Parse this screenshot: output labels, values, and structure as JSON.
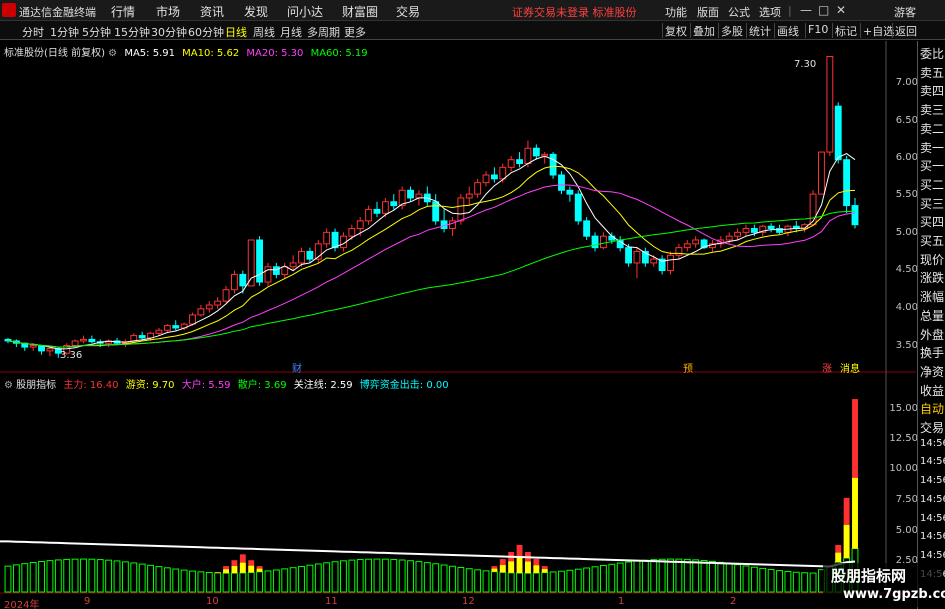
{
  "menubar": {
    "app_title": "通达信金融终端",
    "items": [
      "行情",
      "市场",
      "资讯",
      "发现",
      "问小达",
      "财富圈",
      "交易"
    ],
    "center_message": "证券交易未登录  标准股份",
    "right_items": [
      "功能",
      "版面",
      "公式",
      "选项",
      "|",
      "游客"
    ],
    "window_controls": [
      "—",
      "□",
      "✕"
    ]
  },
  "toolbar": {
    "periods": [
      "分时",
      "1分钟",
      "5分钟",
      "15分钟",
      "30分钟",
      "60分钟",
      "日线",
      "周线",
      "月线",
      "多周期",
      "更多"
    ],
    "active_period": "日线",
    "right_buttons": [
      "复权",
      "叠加",
      "多股",
      "统计",
      "画线",
      "F10",
      "标记",
      "+自选",
      "返回"
    ]
  },
  "main_legend": {
    "title": "标准股份(日线 前复权)",
    "ma": [
      {
        "label": "MA5: 5.91",
        "color": "#ffffff"
      },
      {
        "label": "MA10: 5.62",
        "color": "#ffff00"
      },
      {
        "label": "MA20: 5.30",
        "color": "#ff40ff"
      },
      {
        "label": "MA60: 5.19",
        "color": "#00ff00"
      }
    ]
  },
  "indicator_legend": {
    "title": "股朋指标",
    "items": [
      {
        "label": "主力: 16.40",
        "color": "#ff3030"
      },
      {
        "label": "游资: 9.70",
        "color": "#ffff00"
      },
      {
        "label": "大户: 5.59",
        "color": "#ff40ff"
      },
      {
        "label": "散户: 3.69",
        "color": "#00ff00"
      },
      {
        "label": "关注线: 2.59",
        "color": "#ffffff"
      },
      {
        "label": "博弈资金出击: 0.00",
        "color": "#00ffff"
      }
    ]
  },
  "price_axis": [
    "7.00",
    "6.50",
    "6.00",
    "5.50",
    "5.00",
    "4.50",
    "4.00",
    "3.50"
  ],
  "indicator_axis": [
    "15.00",
    "12.50",
    "10.00",
    "7.50",
    "5.00",
    "2.50"
  ],
  "date_axis": [
    "2024年",
    "9",
    "10",
    "11",
    "12",
    "1",
    "2"
  ],
  "annotations": {
    "high": "7.30",
    "low": "3.36",
    "marks": [
      {
        "text": "财",
        "color": "#4080ff"
      },
      {
        "text": "预",
        "color": "#ffb000"
      },
      {
        "text": "涨",
        "color": "#ff4040"
      },
      {
        "text": "消息",
        "color": "#ffff00"
      }
    ]
  },
  "right_panel": {
    "items": [
      "委比",
      "卖五",
      "卖四",
      "卖三",
      "卖二",
      "卖一",
      "买一",
      "买二",
      "买三",
      "买四",
      "买五",
      "现价",
      "涨跌",
      "涨幅",
      "总量",
      "外盘",
      "换手",
      "净资",
      "收益",
      "自动",
      "交易",
      "14:56",
      "14:56",
      "14:56",
      "14:56",
      "14:56",
      "14:56",
      "14:56",
      "14:56"
    ]
  },
  "watermark": {
    "line1": "股朋指标网",
    "line2": "www.7gpzb.com"
  },
  "chart_data": [
    {
      "type": "candlestick",
      "title": "标准股份(日线 前复权)",
      "ylim": [
        3.2,
        7.45
      ],
      "x_labels": [
        "2024年",
        "9",
        "10",
        "11",
        "12",
        "1",
        "2"
      ],
      "candles": [
        [
          3.6,
          3.62,
          3.55,
          3.58
        ],
        [
          3.58,
          3.6,
          3.5,
          3.55
        ],
        [
          3.55,
          3.56,
          3.45,
          3.5
        ],
        [
          3.5,
          3.55,
          3.45,
          3.52
        ],
        [
          3.52,
          3.53,
          3.4,
          3.45
        ],
        [
          3.45,
          3.5,
          3.38,
          3.48
        ],
        [
          3.48,
          3.5,
          3.36,
          3.42
        ],
        [
          3.42,
          3.55,
          3.4,
          3.52
        ],
        [
          3.52,
          3.6,
          3.5,
          3.58
        ],
        [
          3.58,
          3.65,
          3.55,
          3.6
        ],
        [
          3.6,
          3.65,
          3.55,
          3.57
        ],
        [
          3.57,
          3.6,
          3.5,
          3.55
        ],
        [
          3.55,
          3.6,
          3.5,
          3.58
        ],
        [
          3.58,
          3.62,
          3.53,
          3.55
        ],
        [
          3.55,
          3.6,
          3.5,
          3.57
        ],
        [
          3.57,
          3.68,
          3.55,
          3.65
        ],
        [
          3.65,
          3.7,
          3.6,
          3.62
        ],
        [
          3.62,
          3.7,
          3.58,
          3.68
        ],
        [
          3.68,
          3.75,
          3.65,
          3.72
        ],
        [
          3.72,
          3.8,
          3.7,
          3.78
        ],
        [
          3.78,
          3.85,
          3.72,
          3.75
        ],
        [
          3.75,
          3.82,
          3.72,
          3.8
        ],
        [
          3.8,
          3.95,
          3.78,
          3.92
        ],
        [
          3.92,
          4.05,
          3.9,
          4.0
        ],
        [
          4.0,
          4.1,
          3.95,
          4.05
        ],
        [
          4.05,
          4.15,
          4.0,
          4.1
        ],
        [
          4.1,
          4.3,
          4.08,
          4.25
        ],
        [
          4.25,
          4.5,
          4.2,
          4.45
        ],
        [
          4.45,
          4.5,
          4.2,
          4.3
        ],
        [
          4.3,
          4.9,
          4.3,
          4.9
        ],
        [
          4.9,
          4.95,
          4.3,
          4.35
        ],
        [
          4.35,
          4.6,
          4.3,
          4.55
        ],
        [
          4.55,
          4.6,
          4.4,
          4.45
        ],
        [
          4.45,
          4.6,
          4.4,
          4.55
        ],
        [
          4.55,
          4.7,
          4.5,
          4.6
        ],
        [
          4.6,
          4.8,
          4.55,
          4.75
        ],
        [
          4.75,
          4.8,
          4.6,
          4.65
        ],
        [
          4.65,
          4.9,
          4.6,
          4.85
        ],
        [
          4.85,
          5.05,
          4.8,
          5.0
        ],
        [
          5.0,
          5.05,
          4.75,
          4.8
        ],
        [
          4.8,
          5.0,
          4.75,
          4.95
        ],
        [
          4.95,
          5.1,
          4.9,
          5.05
        ],
        [
          5.05,
          5.2,
          4.95,
          5.15
        ],
        [
          5.15,
          5.35,
          5.1,
          5.3
        ],
        [
          5.3,
          5.4,
          5.2,
          5.25
        ],
        [
          5.25,
          5.45,
          5.2,
          5.4
        ],
        [
          5.4,
          5.5,
          5.3,
          5.35
        ],
        [
          5.35,
          5.6,
          5.3,
          5.55
        ],
        [
          5.55,
          5.6,
          5.4,
          5.45
        ],
        [
          5.45,
          5.55,
          5.35,
          5.5
        ],
        [
          5.5,
          5.6,
          5.35,
          5.4
        ],
        [
          5.4,
          5.5,
          5.1,
          5.15
        ],
        [
          5.15,
          5.3,
          5.0,
          5.05
        ],
        [
          5.05,
          5.2,
          4.95,
          5.15
        ],
        [
          5.15,
          5.5,
          5.1,
          5.45
        ],
        [
          5.45,
          5.6,
          5.35,
          5.5
        ],
        [
          5.5,
          5.7,
          5.45,
          5.65
        ],
        [
          5.65,
          5.8,
          5.6,
          5.75
        ],
        [
          5.75,
          5.85,
          5.65,
          5.7
        ],
        [
          5.7,
          5.9,
          5.65,
          5.85
        ],
        [
          5.85,
          6.0,
          5.8,
          5.95
        ],
        [
          5.95,
          6.05,
          5.85,
          5.9
        ],
        [
          5.9,
          6.2,
          5.85,
          6.1
        ],
        [
          6.1,
          6.15,
          5.95,
          6.0
        ],
        [
          6.0,
          6.05,
          5.9,
          6.02
        ],
        [
          6.02,
          6.05,
          5.7,
          5.75
        ],
        [
          5.75,
          5.8,
          5.5,
          5.55
        ],
        [
          5.55,
          5.6,
          5.4,
          5.5
        ],
        [
          5.5,
          5.55,
          5.1,
          5.15
        ],
        [
          5.15,
          5.2,
          4.9,
          4.95
        ],
        [
          4.95,
          5.0,
          4.75,
          4.8
        ],
        [
          4.8,
          5.0,
          4.78,
          4.95
        ],
        [
          4.95,
          5.0,
          4.85,
          4.9
        ],
        [
          4.9,
          4.95,
          4.75,
          4.8
        ],
        [
          4.8,
          4.85,
          4.55,
          4.6
        ],
        [
          4.6,
          4.8,
          4.4,
          4.75
        ],
        [
          4.75,
          4.8,
          4.55,
          4.6
        ],
        [
          4.6,
          4.7,
          4.55,
          4.65
        ],
        [
          4.65,
          4.7,
          4.45,
          4.5
        ],
        [
          4.5,
          4.75,
          4.45,
          4.7
        ],
        [
          4.7,
          4.85,
          4.65,
          4.8
        ],
        [
          4.8,
          4.9,
          4.75,
          4.85
        ],
        [
          4.85,
          4.95,
          4.8,
          4.9
        ],
        [
          4.9,
          4.92,
          4.78,
          4.8
        ],
        [
          4.8,
          4.9,
          4.75,
          4.85
        ],
        [
          4.85,
          4.95,
          4.8,
          4.9
        ],
        [
          4.9,
          5.0,
          4.85,
          4.95
        ],
        [
          4.95,
          5.05,
          4.9,
          5.0
        ],
        [
          5.0,
          5.1,
          4.95,
          5.05
        ],
        [
          5.05,
          5.1,
          4.95,
          5.0
        ],
        [
          5.0,
          5.1,
          4.95,
          5.08
        ],
        [
          5.08,
          5.12,
          5.0,
          5.05
        ],
        [
          5.05,
          5.1,
          4.98,
          5.0
        ],
        [
          5.0,
          5.1,
          4.95,
          5.08
        ],
        [
          5.08,
          5.15,
          5.0,
          5.05
        ],
        [
          5.05,
          5.12,
          5.0,
          5.1
        ],
        [
          5.1,
          5.55,
          5.08,
          5.5
        ],
        [
          5.5,
          6.05,
          5.5,
          6.05
        ],
        [
          6.05,
          7.3,
          6.0,
          7.3
        ],
        [
          6.65,
          6.7,
          5.9,
          5.95
        ],
        [
          5.95,
          6.0,
          5.25,
          5.35
        ],
        [
          5.35,
          5.45,
          5.05,
          5.1
        ]
      ]
    },
    {
      "type": "bar",
      "title": "股朋指标",
      "ylim": [
        0,
        17
      ],
      "series": [
        {
          "name": "主力",
          "values": [
            16.4
          ]
        },
        {
          "name": "游资",
          "values": [
            9.7
          ]
        },
        {
          "name": "大户",
          "values": [
            5.59
          ]
        },
        {
          "name": "散户",
          "values": [
            3.69
          ]
        },
        {
          "name": "关注线",
          "values": [
            2.59
          ]
        },
        {
          "name": "博弈资金出击",
          "values": [
            0.0
          ]
        }
      ]
    }
  ]
}
